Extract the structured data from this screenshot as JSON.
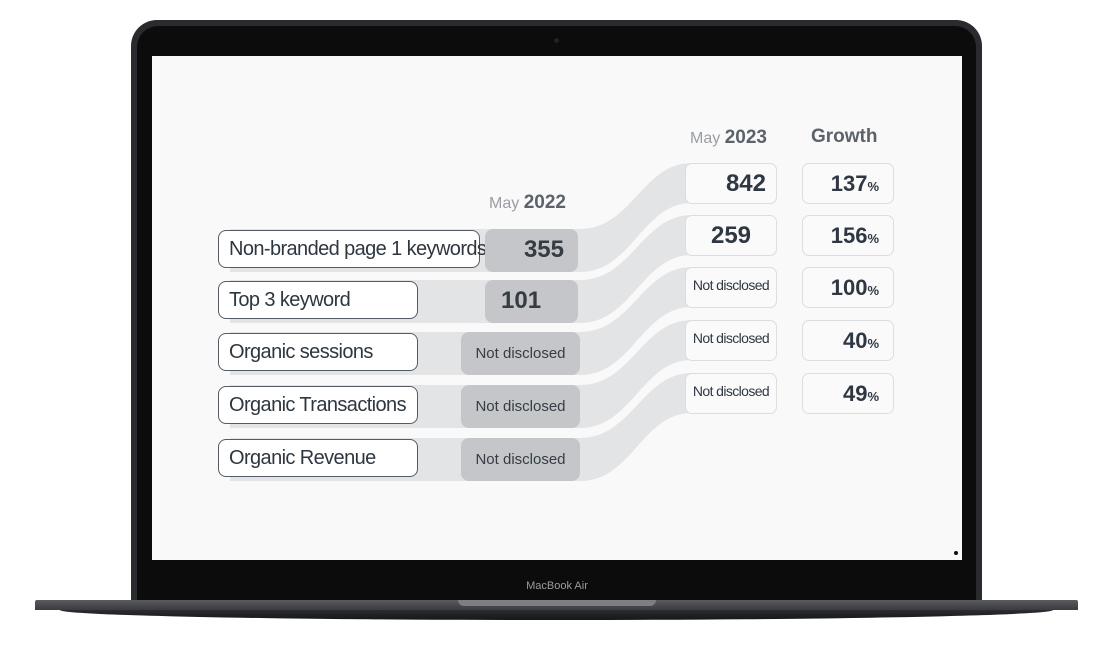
{
  "device": {
    "brand": "MacBook Air"
  },
  "headers": {
    "col2022": {
      "month": "May",
      "year": "2022"
    },
    "col2023": {
      "month": "May",
      "year": "2023"
    },
    "growth": "Growth"
  },
  "rows": [
    {
      "label": "Non-branded page 1 keywords",
      "may2022": "355",
      "may2023": "842",
      "growth": "137",
      "unit": "%"
    },
    {
      "label": "Top 3 keyword",
      "may2022": "101",
      "may2023": "259",
      "growth": "156",
      "unit": "%"
    },
    {
      "label": "Organic sessions",
      "may2022": "Not disclosed",
      "may2023": "Not disclosed",
      "growth": "100",
      "unit": "%"
    },
    {
      "label": "Organic Transactions",
      "may2022": "Not disclosed",
      "may2023": "Not disclosed",
      "growth": "40",
      "unit": "%"
    },
    {
      "label": "Organic Revenue",
      "may2022": "Not disclosed",
      "may2023": "Not disclosed",
      "growth": "49",
      "unit": "%"
    }
  ],
  "colors": {
    "band": "#e3e4e6",
    "value_box_2022": "#c4c6c9",
    "text": "#2f3842"
  }
}
